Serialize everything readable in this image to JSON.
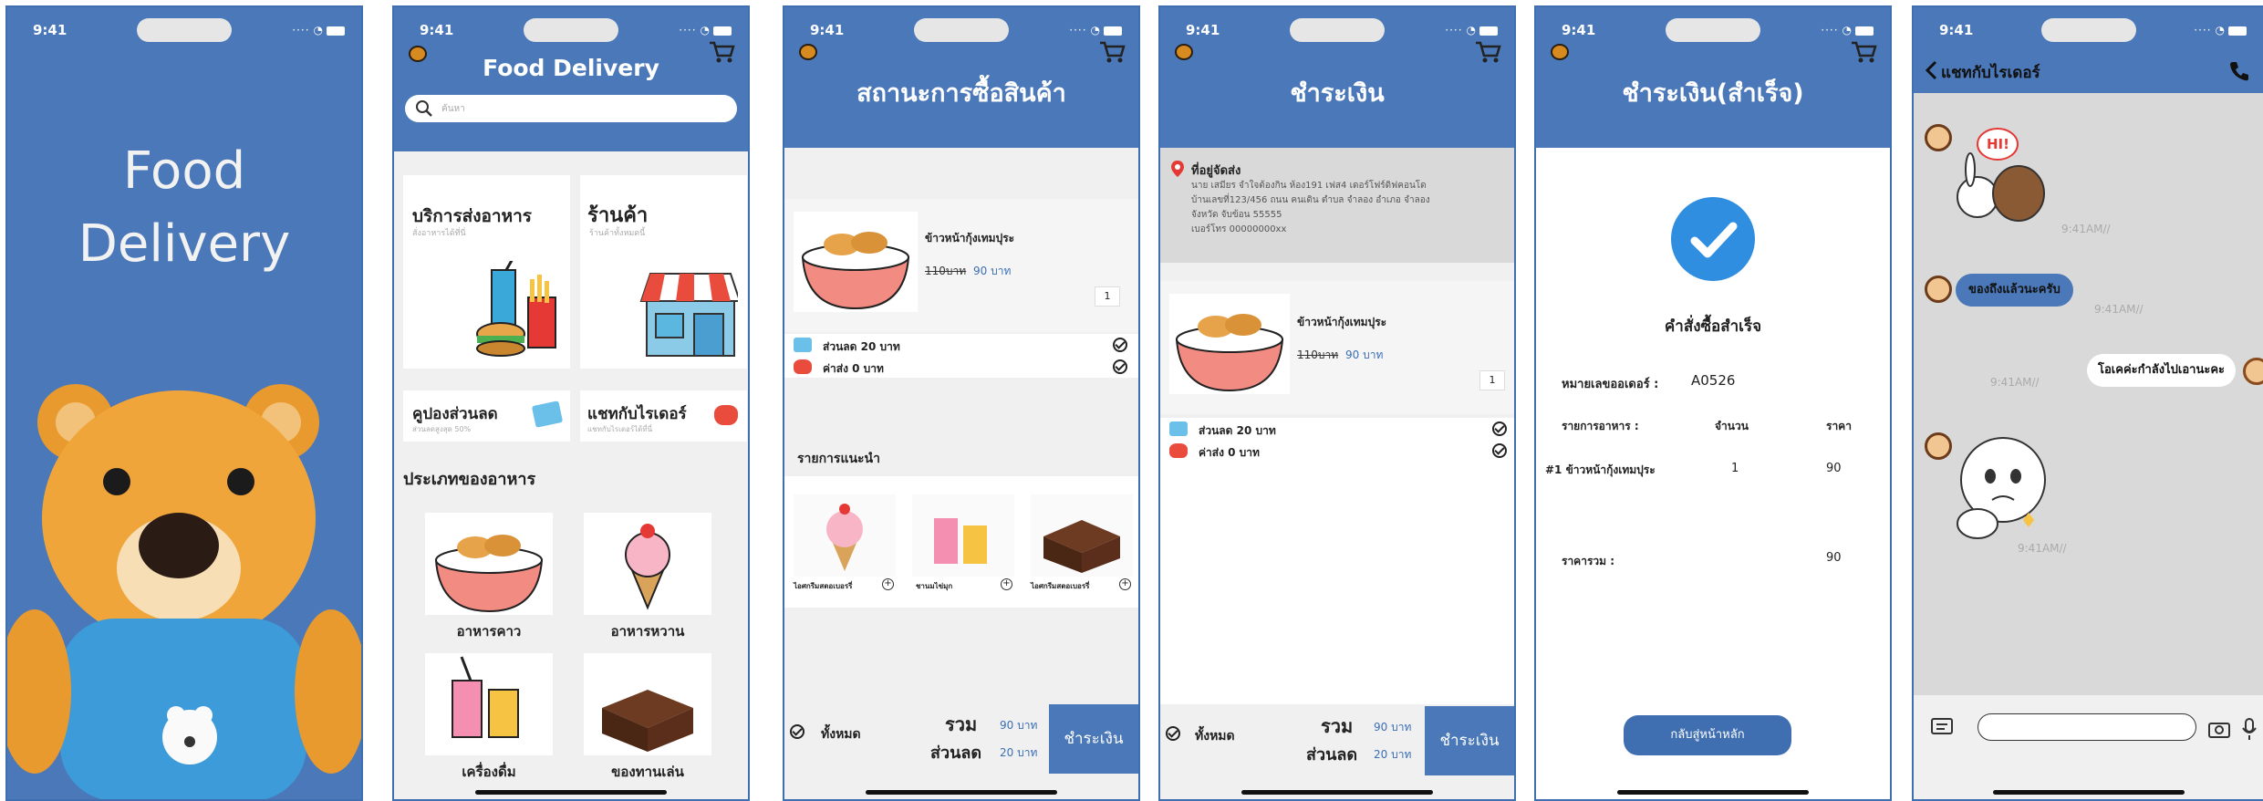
{
  "status_time": "9:41",
  "splash": {
    "line1": "Food",
    "line2": "Delivery"
  },
  "home": {
    "title": "Food Delivery",
    "search_placeholder": "ค้นหา",
    "tile1": {
      "title": "บริการส่งอาหาร",
      "sub": "สั่งอาหารได้ที่นี่"
    },
    "tile2": {
      "title": "ร้านค้า",
      "sub": "ร้านค้าทั้งหมดนี้"
    },
    "tile3": {
      "title": "คูปองส่วนลด",
      "sub": "ส่วนลดสูงสุด 50%"
    },
    "tile4": {
      "title": "แชทกับไรเดอร์",
      "sub": "แชทกับไรเดอร์ได้ที่นี่"
    },
    "category_title": "ประเภทของอาหาร",
    "categories": [
      "อาหารคาว",
      "อาหารหวาน",
      "เครื่องดื่ม",
      "ของทานเล่น"
    ]
  },
  "order": {
    "title": "สถานะการซื้อสินค้า",
    "item_name": "ข้าวหน้ากุ้งเทมปุระ",
    "old_price": "110บาท",
    "new_price": "90 บาท",
    "qty": "1",
    "discount": "ส่วนลด 20 บาท",
    "shipping": "ค่าส่ง 0 บาท",
    "rec_title": "รายการแนะนำ",
    "rec": [
      "ไอศกรีมสตอเบอรรี่",
      "ชานมไข่มุก",
      "ไอศกรีมสตอเบอรรี่"
    ],
    "all": "ทั้งหมด",
    "total_label": "รวม",
    "discount_label": "ส่วนลด",
    "total_value": "90 บาท",
    "discount_value": "20 บาท",
    "pay_button": "ชำระเงิน"
  },
  "payment": {
    "title": "ชำระเงิน",
    "addr_title": "ที่อยู่จัดส่ง",
    "addr_lines": [
      "นาย เสมียร จำใจต้องกิน ห้อง191 เฟส4 เดอร์โฟร์ดิฟคอนโด",
      "บ้านเลขที่123/456 ถนน คนเดิน ตำบล จำลอง อำเภอ จำลอง",
      "จังหวัด จับข้อน 55555",
      "เบอร์โทร 00000000xx"
    ]
  },
  "success": {
    "title": "ชำระเงิน(สำเร็จ)",
    "message": "คำสั่งซื้อสำเร็จ",
    "order_no_label": "หมายเลขออเดอร์ :",
    "order_no": "A0526",
    "col_item": "รายการอาหาร :",
    "col_qty": "จำนวน",
    "col_price": "ราคา",
    "row_item": "#1 ข้าวหน้ากุ้งเทมปุระ",
    "row_qty": "1",
    "row_price": "90",
    "sum_label": "ราคารวม :",
    "sum_value": "90",
    "home_button": "กลับสู่หน้าหลัก"
  },
  "chat": {
    "title": "แชทกับไรเดอร์",
    "sticker_text": "HI!",
    "time": "9:41AM//",
    "msg1": "ของถึงแล้วนะครับ",
    "msg2": "โอเคค่ะกำลังไปเอานะคะ"
  },
  "colors": {
    "brand": "#4a78b8",
    "accent": "#3b6fb5",
    "gray": "#d9d9d9"
  }
}
